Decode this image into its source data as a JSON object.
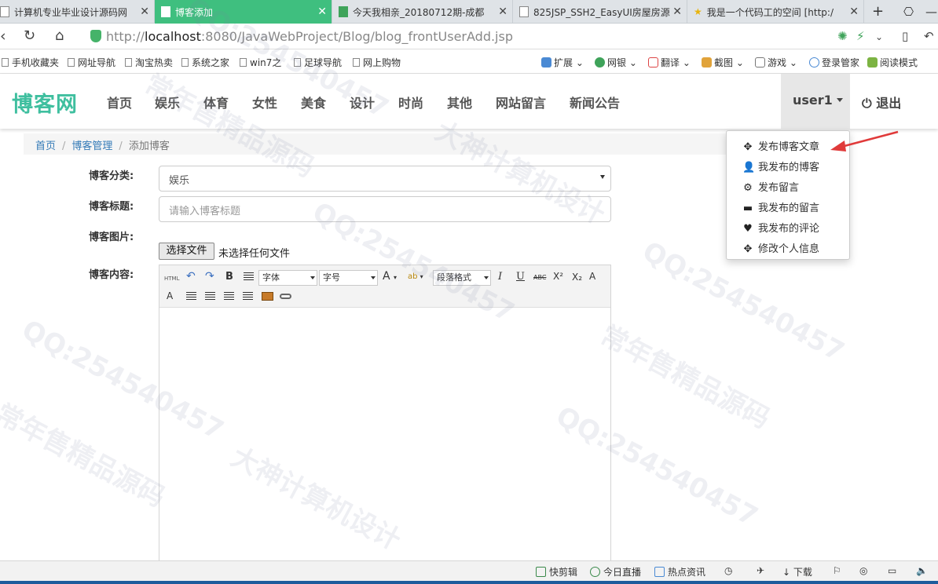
{
  "browser": {
    "tabs": [
      {
        "label": "计算机专业毕业设计源码网"
      },
      {
        "label": "博客添加"
      },
      {
        "label": "今天我相亲_20180712期-成都"
      },
      {
        "label": "825JSP_SSH2_EasyUI房屋房源"
      },
      {
        "label": "我是一个代码工的空间 [http:/"
      }
    ],
    "url_prefix": "http://",
    "url_host": "localhost",
    "url_rest": ":8080/JavaWebProject/Blog/blog_frontUserAdd.jsp",
    "bookmarks": [
      "手机收藏夹",
      "网址导航",
      "淘宝热卖",
      "系统之家",
      "win7之",
      "足球导航",
      "网上购物"
    ],
    "toolbar_right": [
      "扩展",
      "网银",
      "翻译",
      "截图",
      "游戏",
      "登录管家",
      "阅读模式"
    ]
  },
  "site": {
    "logo": "博客网",
    "nav": [
      "首页",
      "娱乐",
      "体育",
      "女性",
      "美食",
      "设计",
      "时尚",
      "其他",
      "网站留言",
      "新闻公告"
    ],
    "user": "user1",
    "logout": "退出"
  },
  "breadcrumb": {
    "home": "首页",
    "section": "博客管理",
    "current": "添加博客"
  },
  "form": {
    "category_label": "博客分类:",
    "category_value": "娱乐",
    "title_label": "博客标题:",
    "title_placeholder": "请输入博客标题",
    "image_label": "博客图片:",
    "file_button": "选择文件",
    "file_status": "未选择任何文件",
    "content_label": "博客内容:"
  },
  "editor": {
    "html_label": "HTML",
    "bold": "B",
    "font_select": "字体",
    "size_select": "字号",
    "font_color": "A",
    "highlight": "ab",
    "format_select": "段落格式",
    "italic": "I",
    "underline": "U",
    "strike": "ABC",
    "superscript": "X²",
    "subscript": "X₂",
    "clear_format": "A"
  },
  "user_menu": [
    {
      "icon": "move-icon",
      "label": "发布博客文章"
    },
    {
      "icon": "user-icon",
      "label": "我发布的博客"
    },
    {
      "icon": "cog-icon",
      "label": "发布留言"
    },
    {
      "icon": "credit-card-icon",
      "label": "我发布的留言"
    },
    {
      "icon": "heart-icon",
      "label": "我发布的评论"
    },
    {
      "icon": "move-icon",
      "label": "修改个人信息"
    }
  ],
  "statusbar": [
    "快剪辑",
    "今日直播",
    "热点资讯",
    "下载"
  ],
  "watermarks": [
    "QQ:254540457",
    "大神计算机设计",
    "常年售精品源码"
  ],
  "colors": {
    "brand": "#3fbf9f",
    "active_tab": "#3fbf7f",
    "link": "#337ab7",
    "arrow": "#e03a3a"
  }
}
